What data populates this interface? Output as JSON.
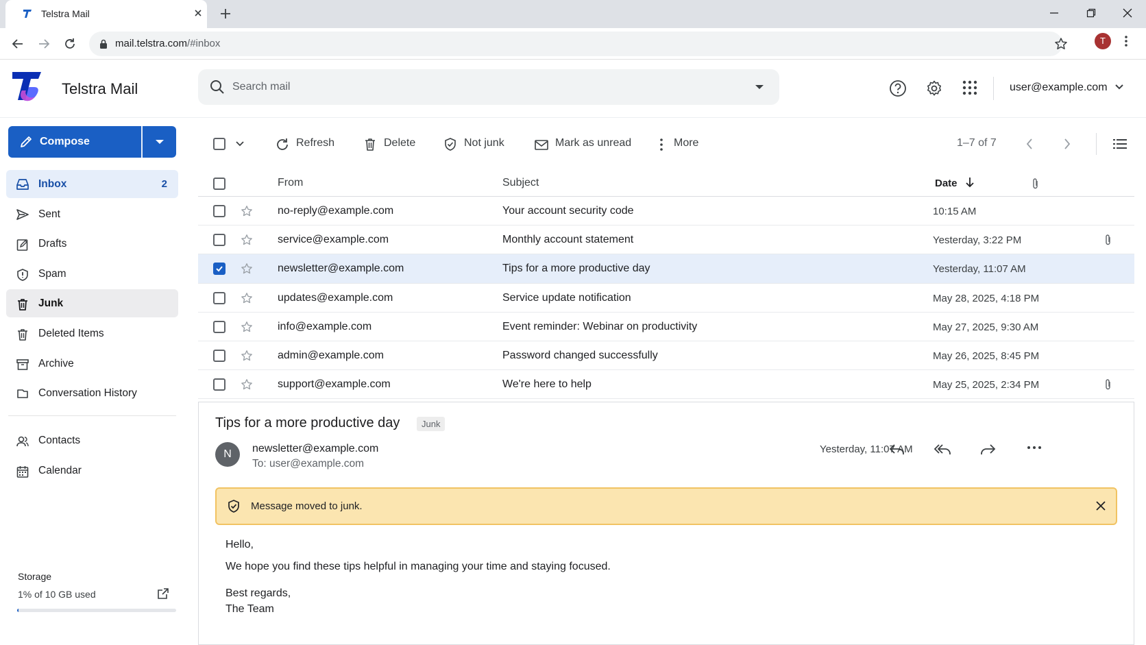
{
  "browser": {
    "tab_title": "Telstra Mail",
    "url_host": "mail.telstra.com",
    "url_path": "/#inbox",
    "profile_initial": "T"
  },
  "header": {
    "app_name": "Telstra Mail",
    "search_placeholder": "Search mail",
    "account": "user@example.com"
  },
  "sidebar": {
    "compose_label": "Compose",
    "items": [
      {
        "label": "Inbox",
        "count": "2",
        "icon": "inbox-icon"
      },
      {
        "label": "Sent",
        "icon": "send-icon"
      },
      {
        "label": "Drafts",
        "icon": "drafts-icon"
      },
      {
        "label": "Spam",
        "icon": "shield-icon"
      },
      {
        "label": "Junk",
        "icon": "trash-icon"
      },
      {
        "label": "Deleted Items",
        "icon": "trash-icon"
      },
      {
        "label": "Archive",
        "icon": "archive-icon"
      },
      {
        "label": "Conversation History",
        "icon": "chat-icon"
      }
    ],
    "secondary": [
      {
        "label": "Contacts",
        "icon": "contacts-icon"
      },
      {
        "label": "Calendar",
        "icon": "calendar-icon"
      }
    ],
    "storage": {
      "title": "Storage",
      "used_text": "1% of 10 GB used",
      "used_fraction": 0.01
    }
  },
  "toolbar": {
    "refresh": "Refresh",
    "delete": "Delete",
    "not_junk": "Not junk",
    "mark_unread": "Mark as unread",
    "more": "More",
    "range": "1–7 of 7"
  },
  "list": {
    "headers": {
      "from": "From",
      "subject": "Subject",
      "date": "Date"
    },
    "rows": [
      {
        "from": "no-reply@example.com",
        "subject": "Your account security code",
        "date": "10:15 AM",
        "attachment": false,
        "selected": false
      },
      {
        "from": "service@example.com",
        "subject": "Monthly account statement",
        "date": "Yesterday, 3:22 PM",
        "attachment": true,
        "selected": false
      },
      {
        "from": "newsletter@example.com",
        "subject": "Tips for a more productive day",
        "date": "Yesterday, 11:07 AM",
        "attachment": false,
        "selected": true
      },
      {
        "from": "updates@example.com",
        "subject": "Service update notification",
        "date": "May 28, 2025, 4:18 PM",
        "attachment": false,
        "selected": false
      },
      {
        "from": "info@example.com",
        "subject": "Event reminder: Webinar on productivity",
        "date": "May 27, 2025, 9:30 AM",
        "attachment": false,
        "selected": false
      },
      {
        "from": "admin@example.com",
        "subject": "Password changed successfully",
        "date": "May 26, 2025, 8:45 PM",
        "attachment": false,
        "selected": false
      },
      {
        "from": "support@example.com",
        "subject": "We're here to help",
        "date": "May 25, 2025, 2:34 PM",
        "attachment": true,
        "selected": false
      }
    ]
  },
  "message": {
    "subject": "Tips for a more productive day",
    "badge": "Junk",
    "avatar_initial": "N",
    "from": "newsletter@example.com",
    "to": "To: user@example.com",
    "date": "Yesterday, 11:07 AM",
    "alert": "Message moved to junk.",
    "body": {
      "greeting": "Hello,",
      "line1": "We hope you find these tips helpful in managing your time and staying focused.",
      "signoff": "Best regards,",
      "signature": "The Team"
    }
  },
  "colors": {
    "accent": "#1a5fc4",
    "selected_row": "#e6eefa",
    "alert_bg": "#fbe5b0"
  }
}
